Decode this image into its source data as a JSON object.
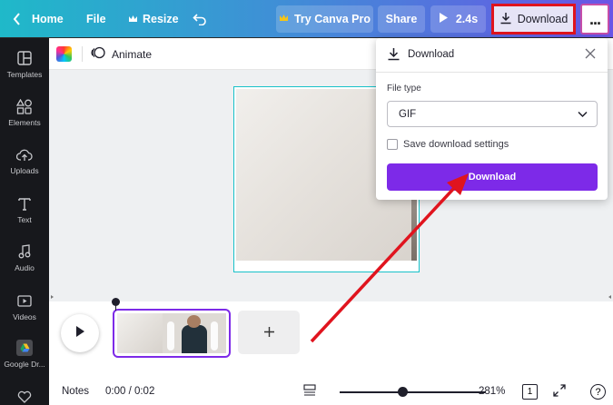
{
  "topbar": {
    "home_label": "Home",
    "file_label": "File",
    "resize_label": "Resize",
    "try_pro_label": "Try Canva Pro",
    "share_label": "Share",
    "play_duration": "2.4s",
    "download_label": "Download",
    "more_label": "..."
  },
  "sidebar": {
    "items": [
      {
        "label": "Templates",
        "icon": "templates-icon"
      },
      {
        "label": "Elements",
        "icon": "elements-icon"
      },
      {
        "label": "Uploads",
        "icon": "uploads-icon"
      },
      {
        "label": "Text",
        "icon": "text-icon"
      },
      {
        "label": "Audio",
        "icon": "audio-icon"
      },
      {
        "label": "Videos",
        "icon": "videos-icon"
      },
      {
        "label": "Google Dr...",
        "icon": "google-drive-icon"
      }
    ]
  },
  "subbar": {
    "animate_label": "Animate"
  },
  "download_panel": {
    "title": "Download",
    "file_type_label": "File type",
    "file_type_value": "GIF",
    "save_settings_label": "Save download settings",
    "save_settings_checked": false,
    "download_button_label": "Download"
  },
  "footer": {
    "notes_label": "Notes",
    "time": "0:00 / 0:02",
    "zoom": "281%",
    "page_number": "1",
    "help_label": "?"
  },
  "colors": {
    "accent": "#7d2ae8",
    "highlight_box": "#e0141e",
    "canvas_selection": "#18c2c9"
  }
}
